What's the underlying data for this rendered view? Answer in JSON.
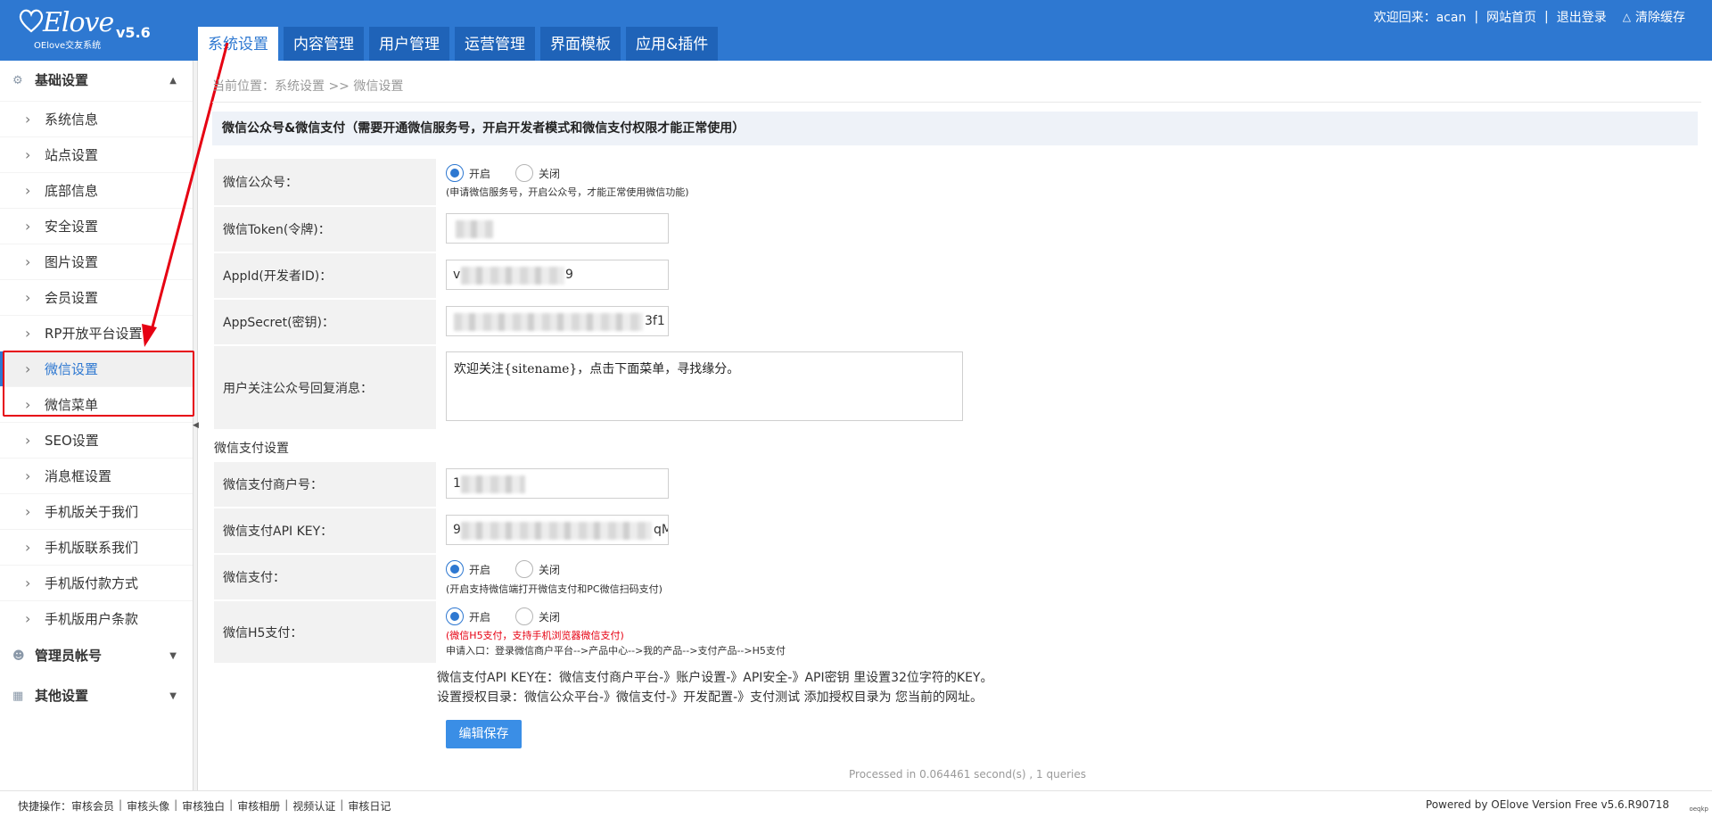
{
  "brand": {
    "logo_script": "Elove",
    "logo_sub": "OElove交友系统",
    "version": "v5.6"
  },
  "topnav": {
    "tabs": [
      "系统设置",
      "内容管理",
      "用户管理",
      "运营管理",
      "界面模板",
      "应用&插件"
    ]
  },
  "toplinks": {
    "welcome": "欢迎回来：acan",
    "site_home": "网站首页",
    "logout": "退出登录",
    "clear_cache": "清除缓存"
  },
  "sidebar": {
    "group_basic": "基础设置",
    "items": [
      "系统信息",
      "站点设置",
      "底部信息",
      "安全设置",
      "图片设置",
      "会员设置",
      "RP开放平台设置",
      "微信设置",
      "微信菜单",
      "SEO设置",
      "消息框设置",
      "手机版关于我们",
      "手机版联系我们",
      "手机版付款方式",
      "手机版用户条款"
    ],
    "group_admin": "管理员帐号",
    "group_other": "其他设置"
  },
  "breadcrumb": "当前位置：系统设置 >> 微信设置",
  "panel_title": "微信公众号&微信支付（需要开通微信服务号，开启开发者模式和微信支付权限才能正常使用）",
  "form": {
    "wx_official": {
      "label": "微信公众号：",
      "on": "开启",
      "off": "关闭",
      "hint": "(申请微信服务号，开启公众号，才能正常使用微信功能)"
    },
    "token": {
      "label": "微信Token(令牌)："
    },
    "appid": {
      "label": "AppId(开发者ID)：",
      "prefix": "v",
      "suffix": "9"
    },
    "appsecret": {
      "label": "AppSecret(密钥)：",
      "suffix": "3f1"
    },
    "reply": {
      "label": "用户关注公众号回复消息：",
      "value": "欢迎关注{sitename}，点击下面菜单，寻找缘分。"
    },
    "pay_section": "微信支付设置",
    "mch_id": {
      "label": "微信支付商户号：",
      "prefix": "1"
    },
    "api_key": {
      "label": "微信支付API KEY：",
      "prefix": "9",
      "suffix": "qM"
    },
    "wx_pay": {
      "label": "微信支付：",
      "on": "开启",
      "off": "关闭",
      "hint": "(开启支持微信端打开微信支付和PC微信扫码支付)"
    },
    "h5_pay": {
      "label": "微信H5支付：",
      "on": "开启",
      "off": "关闭",
      "hint_red": "(微信H5支付，支持手机浏览器微信支付)",
      "hint": "申请入口：登录微信商户平台-->产品中心-->我的产品-->支付产品-->H5支付"
    }
  },
  "notes": {
    "line1": "微信支付API KEY在：微信支付商户平台-》账户设置-》API安全-》API密钥 里设置32位字符的KEY。",
    "line2": "设置授权目录：微信公众平台-》微信支付-》开发配置-》支付测试 添加授权目录为 您当前的网址。"
  },
  "save_button": "编辑保存",
  "processed": "Processed in 0.064461 second(s) , 1 queries",
  "footer": {
    "quick_label": "快捷操作：",
    "quick_links": [
      "审核会员",
      "审核头像",
      "审核独白",
      "审核相册",
      "视频认证",
      "审核日记"
    ],
    "powered": "Powered by OElove Version Free v5.6.R90718",
    "corner": "oeqkp"
  },
  "colors": {
    "header_blue": "#2e78d1",
    "tab_dark": "#1f63b8",
    "highlight_red": "#e60012"
  }
}
